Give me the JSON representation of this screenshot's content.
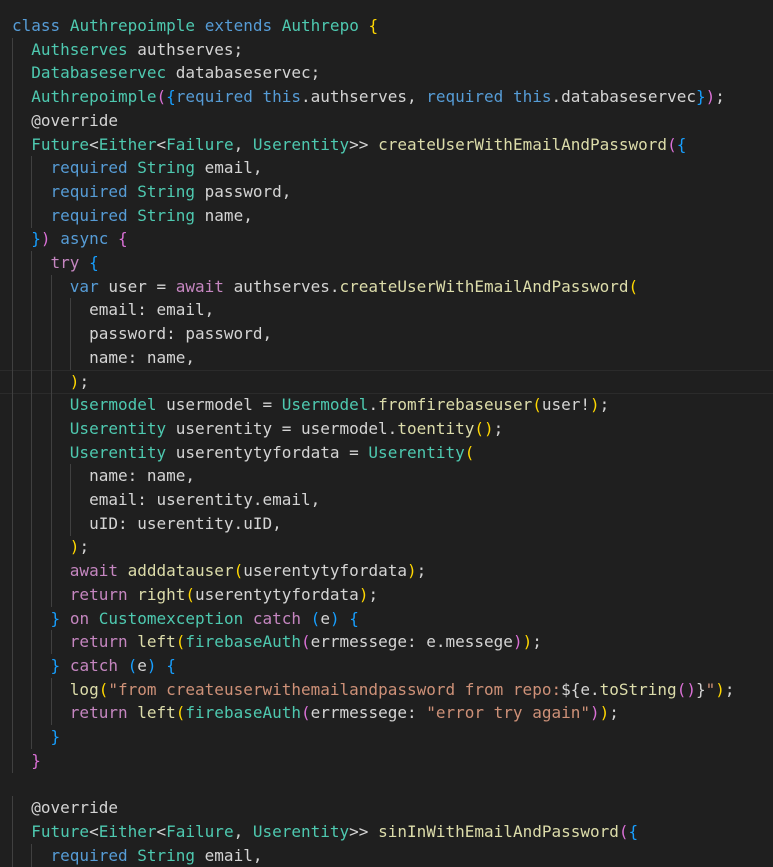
{
  "editor": {
    "language": "dart",
    "theme_colors": {
      "background": "#1f1f1f",
      "keyword": "#569cd6",
      "control": "#c586c0",
      "type": "#4ec9b0",
      "function": "#dcdcaa",
      "variable": "#9cdcfe",
      "string": "#ce9178",
      "text": "#d4d4d4",
      "bracket_level_1": "#ffd700",
      "bracket_level_2": "#da70d6",
      "bracket_level_3": "#179fff"
    },
    "active_line_index": 15,
    "lines": [
      {
        "indent": 0,
        "tokens": [
          [
            "kw",
            "class"
          ],
          [
            "txt",
            " "
          ],
          [
            "type",
            "Authrepoimple"
          ],
          [
            "txt",
            " "
          ],
          [
            "kw",
            "extends"
          ],
          [
            "txt",
            " "
          ],
          [
            "type",
            "Authrepo"
          ],
          [
            "txt",
            " "
          ],
          [
            "b1",
            "{"
          ]
        ]
      },
      {
        "indent": 1,
        "tokens": [
          [
            "type",
            "Authserves"
          ],
          [
            "txt",
            " authserves;"
          ]
        ]
      },
      {
        "indent": 1,
        "tokens": [
          [
            "type",
            "Databaseservec"
          ],
          [
            "txt",
            " databaseservec;"
          ]
        ]
      },
      {
        "indent": 1,
        "tokens": [
          [
            "type",
            "Authrepoimple"
          ],
          [
            "b2",
            "("
          ],
          [
            "b3",
            "{"
          ],
          [
            "kw",
            "required"
          ],
          [
            "txt",
            " "
          ],
          [
            "kw",
            "this"
          ],
          [
            "txt",
            ".authserves, "
          ],
          [
            "kw",
            "required"
          ],
          [
            "txt",
            " "
          ],
          [
            "kw",
            "this"
          ],
          [
            "txt",
            ".databaseservec"
          ],
          [
            "b3",
            "}"
          ],
          [
            "b2",
            ")"
          ],
          [
            "txt",
            ";"
          ]
        ]
      },
      {
        "indent": 1,
        "tokens": [
          [
            "txt",
            "@override"
          ]
        ]
      },
      {
        "indent": 1,
        "tokens": [
          [
            "type",
            "Future"
          ],
          [
            "txt",
            "<"
          ],
          [
            "type",
            "Either"
          ],
          [
            "txt",
            "<"
          ],
          [
            "type",
            "Failure"
          ],
          [
            "txt",
            ", "
          ],
          [
            "type",
            "Userentity"
          ],
          [
            "txt",
            ">> "
          ],
          [
            "fn",
            "createUserWithEmailAndPassword"
          ],
          [
            "b2",
            "("
          ],
          [
            "b3",
            "{"
          ]
        ]
      },
      {
        "indent": 2,
        "tokens": [
          [
            "kw",
            "required"
          ],
          [
            "txt",
            " "
          ],
          [
            "type",
            "String"
          ],
          [
            "txt",
            " email,"
          ]
        ]
      },
      {
        "indent": 2,
        "tokens": [
          [
            "kw",
            "required"
          ],
          [
            "txt",
            " "
          ],
          [
            "type",
            "String"
          ],
          [
            "txt",
            " password,"
          ]
        ]
      },
      {
        "indent": 2,
        "tokens": [
          [
            "kw",
            "required"
          ],
          [
            "txt",
            " "
          ],
          [
            "type",
            "String"
          ],
          [
            "txt",
            " name,"
          ]
        ]
      },
      {
        "indent": 1,
        "tokens": [
          [
            "b3",
            "}"
          ],
          [
            "b2",
            ")"
          ],
          [
            "txt",
            " "
          ],
          [
            "kw",
            "async"
          ],
          [
            "txt",
            " "
          ],
          [
            "b2",
            "{"
          ]
        ]
      },
      {
        "indent": 2,
        "tokens": [
          [
            "ctl",
            "try"
          ],
          [
            "txt",
            " "
          ],
          [
            "b3",
            "{"
          ]
        ]
      },
      {
        "indent": 3,
        "tokens": [
          [
            "kw",
            "var"
          ],
          [
            "txt",
            " user = "
          ],
          [
            "ctl",
            "await"
          ],
          [
            "txt",
            " authserves."
          ],
          [
            "fn",
            "createUserWithEmailAndPassword"
          ],
          [
            "b1",
            "("
          ]
        ]
      },
      {
        "indent": 4,
        "tokens": [
          [
            "txt",
            "email: email,"
          ]
        ]
      },
      {
        "indent": 4,
        "tokens": [
          [
            "txt",
            "password: password,"
          ]
        ]
      },
      {
        "indent": 4,
        "tokens": [
          [
            "txt",
            "name: name,"
          ]
        ]
      },
      {
        "indent": 3,
        "tokens": [
          [
            "b1",
            ")"
          ],
          [
            "txt",
            ";"
          ]
        ]
      },
      {
        "indent": 3,
        "tokens": [
          [
            "type",
            "Usermodel"
          ],
          [
            "txt",
            " usermodel = "
          ],
          [
            "type",
            "Usermodel"
          ],
          [
            "txt",
            "."
          ],
          [
            "fn",
            "fromfirebaseuser"
          ],
          [
            "b1",
            "("
          ],
          [
            "txt",
            "user!"
          ],
          [
            "b1",
            ")"
          ],
          [
            "txt",
            ";"
          ]
        ]
      },
      {
        "indent": 3,
        "tokens": [
          [
            "type",
            "Userentity"
          ],
          [
            "txt",
            " userentity = usermodel."
          ],
          [
            "fn",
            "toentity"
          ],
          [
            "b1",
            "("
          ],
          [
            "b1",
            ")"
          ],
          [
            "txt",
            ";"
          ]
        ]
      },
      {
        "indent": 3,
        "tokens": [
          [
            "type",
            "Userentity"
          ],
          [
            "txt",
            " userentytyfordata = "
          ],
          [
            "type",
            "Userentity"
          ],
          [
            "b1",
            "("
          ]
        ]
      },
      {
        "indent": 4,
        "tokens": [
          [
            "txt",
            "name: name,"
          ]
        ]
      },
      {
        "indent": 4,
        "tokens": [
          [
            "txt",
            "email: userentity.email,"
          ]
        ]
      },
      {
        "indent": 4,
        "tokens": [
          [
            "txt",
            "uID: userentity.uID,"
          ]
        ]
      },
      {
        "indent": 3,
        "tokens": [
          [
            "b1",
            ")"
          ],
          [
            "txt",
            ";"
          ]
        ]
      },
      {
        "indent": 3,
        "tokens": [
          [
            "ctl",
            "await"
          ],
          [
            "txt",
            " "
          ],
          [
            "fn",
            "adddatauser"
          ],
          [
            "b1",
            "("
          ],
          [
            "txt",
            "userentytyfordata"
          ],
          [
            "b1",
            ")"
          ],
          [
            "txt",
            ";"
          ]
        ]
      },
      {
        "indent": 3,
        "tokens": [
          [
            "ctl",
            "return"
          ],
          [
            "txt",
            " "
          ],
          [
            "fn",
            "right"
          ],
          [
            "b1",
            "("
          ],
          [
            "txt",
            "userentytyfordata"
          ],
          [
            "b1",
            ")"
          ],
          [
            "txt",
            ";"
          ]
        ]
      },
      {
        "indent": 2,
        "tokens": [
          [
            "b3",
            "}"
          ],
          [
            "txt",
            " "
          ],
          [
            "ctl",
            "on"
          ],
          [
            "txt",
            " "
          ],
          [
            "type",
            "Customexception"
          ],
          [
            "txt",
            " "
          ],
          [
            "ctl",
            "catch"
          ],
          [
            "txt",
            " "
          ],
          [
            "b3",
            "("
          ],
          [
            "txt",
            "e"
          ],
          [
            "b3",
            ")"
          ],
          [
            "txt",
            " "
          ],
          [
            "b3",
            "{"
          ]
        ]
      },
      {
        "indent": 3,
        "tokens": [
          [
            "ctl",
            "return"
          ],
          [
            "txt",
            " "
          ],
          [
            "fn",
            "left"
          ],
          [
            "b1",
            "("
          ],
          [
            "type",
            "firebaseAuth"
          ],
          [
            "b2",
            "("
          ],
          [
            "txt",
            "errmessege: e.messege"
          ],
          [
            "b2",
            ")"
          ],
          [
            "b1",
            ")"
          ],
          [
            "txt",
            ";"
          ]
        ]
      },
      {
        "indent": 2,
        "tokens": [
          [
            "b3",
            "}"
          ],
          [
            "txt",
            " "
          ],
          [
            "ctl",
            "catch"
          ],
          [
            "txt",
            " "
          ],
          [
            "b3",
            "("
          ],
          [
            "txt",
            "e"
          ],
          [
            "b3",
            ")"
          ],
          [
            "txt",
            " "
          ],
          [
            "b3",
            "{"
          ]
        ]
      },
      {
        "indent": 3,
        "tokens": [
          [
            "fn",
            "log"
          ],
          [
            "b1",
            "("
          ],
          [
            "str",
            "\"from createuserwithemailandpassword from repo:"
          ],
          [
            "txt",
            "${e."
          ],
          [
            "fn",
            "toString"
          ],
          [
            "b2",
            "("
          ],
          [
            "b2",
            ")"
          ],
          [
            "txt",
            "}"
          ],
          [
            "str",
            "\""
          ],
          [
            "b1",
            ")"
          ],
          [
            "txt",
            ";"
          ]
        ]
      },
      {
        "indent": 3,
        "tokens": [
          [
            "ctl",
            "return"
          ],
          [
            "txt",
            " "
          ],
          [
            "fn",
            "left"
          ],
          [
            "b1",
            "("
          ],
          [
            "type",
            "firebaseAuth"
          ],
          [
            "b2",
            "("
          ],
          [
            "txt",
            "errmessege: "
          ],
          [
            "str",
            "\"error try again\""
          ],
          [
            "b2",
            ")"
          ],
          [
            "b1",
            ")"
          ],
          [
            "txt",
            ";"
          ]
        ]
      },
      {
        "indent": 2,
        "tokens": [
          [
            "b3",
            "}"
          ]
        ]
      },
      {
        "indent": 1,
        "tokens": [
          [
            "b2",
            "}"
          ]
        ]
      },
      {
        "indent": 0,
        "tokens": []
      },
      {
        "indent": 1,
        "tokens": [
          [
            "txt",
            "@override"
          ]
        ]
      },
      {
        "indent": 1,
        "tokens": [
          [
            "type",
            "Future"
          ],
          [
            "txt",
            "<"
          ],
          [
            "type",
            "Either"
          ],
          [
            "txt",
            "<"
          ],
          [
            "type",
            "Failure"
          ],
          [
            "txt",
            ", "
          ],
          [
            "type",
            "Userentity"
          ],
          [
            "txt",
            ">> "
          ],
          [
            "fn",
            "sinInWithEmailAndPassword"
          ],
          [
            "b2",
            "("
          ],
          [
            "b3",
            "{"
          ]
        ]
      },
      {
        "indent": 2,
        "tokens": [
          [
            "kw",
            "required"
          ],
          [
            "txt",
            " "
          ],
          [
            "type",
            "String"
          ],
          [
            "txt",
            " email,"
          ]
        ]
      }
    ]
  }
}
